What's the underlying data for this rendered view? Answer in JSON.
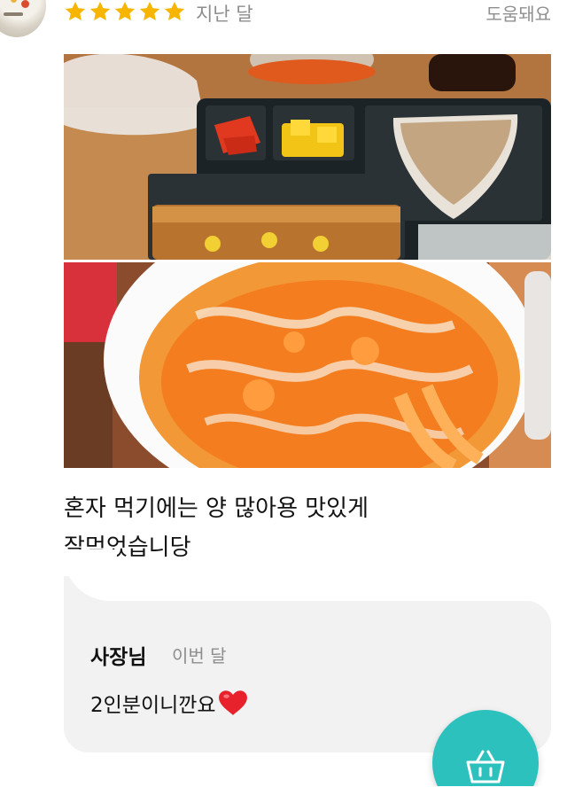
{
  "review": {
    "rating": 5,
    "rating_max": 5,
    "date": "지난 달",
    "helpful_label": "도움돼요",
    "text": "혼자 먹기에는 양 많아용 맛있게\n잘먹었습니당",
    "photos": [
      "lunchbox-photo",
      "tteokbokki-photo"
    ]
  },
  "owner_reply": {
    "name": "사장님",
    "date": "이번 달",
    "message": "2인분이니깐요"
  },
  "cart_button": {
    "icon": "cart-basket-icon"
  },
  "colors": {
    "star": "#f7b500",
    "accent": "#2dc1be",
    "reply_bg": "#f2f2f2",
    "heart": "#e8222c"
  }
}
